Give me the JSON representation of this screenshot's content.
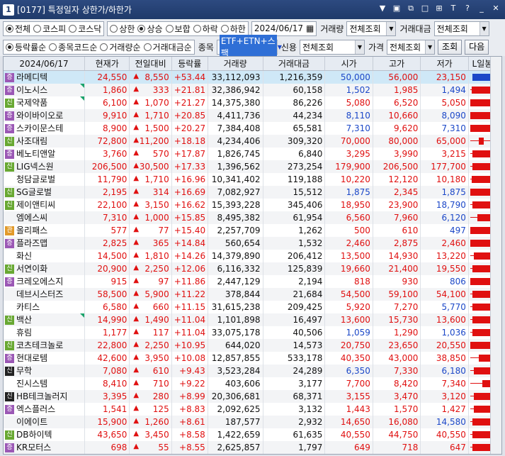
{
  "window": {
    "number": "1",
    "title": "[0177] 특정일자 상한가/하한가"
  },
  "filter1": {
    "market": [
      "전체",
      "코스피",
      "코스닥"
    ],
    "market_selected": 0,
    "direction": [
      "상한",
      "상승",
      "보합",
      "하락",
      "하한"
    ],
    "direction_selected": 1,
    "date": "2024/06/17",
    "volume_label": "거래량",
    "volume_value": "전체조회",
    "amount_label": "거래대금",
    "amount_value": "전체조회"
  },
  "filter2": {
    "sort": [
      "등락률순",
      "종목코드순",
      "거래량순",
      "거래대금순"
    ],
    "sort_selected": 0,
    "item_label": "종목",
    "item_value": "ETF+ETN+스팩",
    "credit_label": "신용",
    "credit_value": "전체조회",
    "price_label": "가격",
    "price_value": "전체조회",
    "search_button": "조회",
    "next_button": "다음"
  },
  "table": {
    "headers": [
      "2024/06/17",
      "현재가",
      "전일대비",
      "등락률",
      "거래량",
      "거래대금",
      "시가",
      "고가",
      "저가",
      "L일봉H"
    ],
    "rows": [
      {
        "tag": "증",
        "tc": "p",
        "name": "라메디텍",
        "price": "24,550",
        "chg": "8,550",
        "rate": "+53.44",
        "vol": "33,112,093",
        "amt": "1,216,359",
        "open": "50,000",
        "high": "56,000",
        "low": "23,150",
        "ob": true,
        "hb": false,
        "lb": false,
        "bar": [
          10,
          95,
          10,
          95,
          "b"
        ],
        "sel": true
      },
      {
        "tag": "증",
        "tc": "p",
        "name": "이노시스",
        "price": "1,860",
        "chg": "333",
        "rate": "+21.81",
        "vol": "32,386,942",
        "amt": "60,158",
        "open": "1,502",
        "high": "1,985",
        "low": "1,494",
        "ob": true,
        "hb": false,
        "lb": true,
        "bar": [
          5,
          95,
          8,
          80,
          "r"
        ],
        "flag": true
      },
      {
        "tag": "신",
        "tc": "g",
        "name": "국제약품",
        "price": "6,100",
        "chg": "1,070",
        "rate": "+21.27",
        "vol": "14,375,380",
        "amt": "86,226",
        "open": "5,080",
        "high": "6,520",
        "low": "5,050",
        "ob": false,
        "hb": false,
        "lb": false,
        "bar": [
          5,
          95,
          5,
          80,
          "r"
        ],
        "flag": true
      },
      {
        "tag": "증",
        "tc": "p",
        "name": "와이바이오로",
        "price": "9,910",
        "chg": "1,710",
        "rate": "+20.85",
        "vol": "4,411,736",
        "amt": "44,234",
        "open": "8,110",
        "high": "10,660",
        "low": "8,090",
        "ob": true,
        "hb": false,
        "lb": true,
        "bar": [
          5,
          95,
          5,
          75,
          "r"
        ]
      },
      {
        "tag": "증",
        "tc": "p",
        "name": "스카이문스테",
        "price": "8,900",
        "chg": "1,500",
        "rate": "+20.27",
        "vol": "7,384,408",
        "amt": "65,581",
        "open": "7,310",
        "high": "9,620",
        "low": "7,310",
        "ob": true,
        "hb": false,
        "lb": true,
        "bar": [
          5,
          95,
          5,
          72,
          "r"
        ]
      },
      {
        "tag": "신",
        "tc": "g",
        "name": "사조대림",
        "price": "72,800",
        "chg": "11,200",
        "rate": "+18.18",
        "vol": "4,234,406",
        "amt": "309,320",
        "open": "70,000",
        "high": "80,000",
        "low": "65,000",
        "ob": false,
        "hb": false,
        "lb": false,
        "bar": [
          5,
          95,
          30,
          45,
          "r"
        ]
      },
      {
        "tag": "증",
        "tc": "p",
        "name": "베노티앤알",
        "price": "3,760",
        "chg": "570",
        "rate": "+17.87",
        "vol": "1,826,745",
        "amt": "6,840",
        "open": "3,295",
        "high": "3,990",
        "low": "3,215",
        "ob": false,
        "hb": false,
        "lb": false,
        "bar": [
          5,
          95,
          10,
          80,
          "r"
        ]
      },
      {
        "tag": "신",
        "tc": "g",
        "name": "LIG넥스원",
        "price": "206,500",
        "chg": "30,500",
        "rate": "+17.33",
        "vol": "1,396,562",
        "amt": "273,254",
        "open": "179,900",
        "high": "206,500",
        "low": "177,700",
        "ob": false,
        "hb": false,
        "lb": false,
        "bar": [
          5,
          95,
          10,
          95,
          "r"
        ]
      },
      {
        "tag": "",
        "tc": "n",
        "name": "청담글로벌",
        "price": "11,790",
        "chg": "1,710",
        "rate": "+16.96",
        "vol": "10,341,402",
        "amt": "119,188",
        "open": "10,220",
        "high": "12,120",
        "low": "10,180",
        "ob": false,
        "hb": false,
        "lb": false,
        "bar": [
          5,
          95,
          8,
          82,
          "r"
        ]
      },
      {
        "tag": "신",
        "tc": "g",
        "name": "SG글로벌",
        "price": "2,195",
        "chg": "314",
        "rate": "+16.69",
        "vol": "7,082,927",
        "amt": "15,512",
        "open": "1,875",
        "high": "2,345",
        "low": "1,875",
        "ob": true,
        "hb": false,
        "lb": true,
        "bar": [
          5,
          95,
          5,
          80,
          "r"
        ]
      },
      {
        "tag": "신",
        "tc": "g",
        "name": "제이앤티씨",
        "price": "22,100",
        "chg": "3,150",
        "rate": "+16.62",
        "vol": "15,393,228",
        "amt": "345,406",
        "open": "18,950",
        "high": "23,900",
        "low": "18,790",
        "ob": false,
        "hb": false,
        "lb": true,
        "bar": [
          5,
          95,
          10,
          75,
          "r"
        ]
      },
      {
        "tag": "",
        "tc": "n",
        "name": "엠에스씨",
        "price": "7,310",
        "chg": "1,000",
        "rate": "+15.85",
        "vol": "8,495,382",
        "amt": "61,954",
        "open": "6,560",
        "high": "7,960",
        "low": "6,120",
        "ob": false,
        "hb": false,
        "lb": true,
        "bar": [
          5,
          95,
          25,
          75,
          "r"
        ]
      },
      {
        "tag": "관",
        "tc": "o",
        "name": "올리패스",
        "price": "577",
        "chg": "77",
        "rate": "+15.40",
        "vol": "2,257,709",
        "amt": "1,262",
        "open": "500",
        "high": "610",
        "low": "497",
        "ob": false,
        "hb": false,
        "lb": true,
        "bar": [
          5,
          95,
          5,
          70,
          "r"
        ]
      },
      {
        "tag": "증",
        "tc": "p",
        "name": "플라즈맵",
        "price": "2,825",
        "chg": "365",
        "rate": "+14.84",
        "vol": "560,654",
        "amt": "1,532",
        "open": "2,460",
        "high": "2,875",
        "low": "2,460",
        "ob": false,
        "hb": false,
        "lb": false,
        "bar": [
          5,
          95,
          5,
          85,
          "r"
        ]
      },
      {
        "tag": "",
        "tc": "n",
        "name": "화신",
        "price": "14,500",
        "chg": "1,810",
        "rate": "+14.26",
        "vol": "14,379,890",
        "amt": "206,412",
        "open": "13,500",
        "high": "14,930",
        "low": "13,220",
        "ob": false,
        "hb": false,
        "lb": false,
        "bar": [
          5,
          95,
          15,
          80,
          "r"
        ]
      },
      {
        "tag": "신",
        "tc": "g",
        "name": "서연이화",
        "price": "20,900",
        "chg": "2,250",
        "rate": "+12.06",
        "vol": "6,116,332",
        "amt": "125,839",
        "open": "19,660",
        "high": "21,400",
        "low": "19,550",
        "ob": false,
        "hb": false,
        "lb": false,
        "bar": [
          5,
          95,
          10,
          80,
          "r"
        ]
      },
      {
        "tag": "증",
        "tc": "p",
        "name": "크레오에스지",
        "price": "915",
        "chg": "97",
        "rate": "+11.86",
        "vol": "2,447,129",
        "amt": "2,194",
        "open": "818",
        "high": "930",
        "low": "806",
        "ob": false,
        "hb": false,
        "lb": true,
        "bar": [
          5,
          95,
          5,
          85,
          "r"
        ]
      },
      {
        "tag": "",
        "tc": "n",
        "name": "데브시스터즈",
        "price": "58,500",
        "chg": "5,900",
        "rate": "+11.22",
        "vol": "378,844",
        "amt": "21,684",
        "open": "54,500",
        "high": "59,100",
        "low": "54,100",
        "ob": false,
        "hb": false,
        "lb": false,
        "bar": [
          5,
          95,
          10,
          90,
          "r"
        ]
      },
      {
        "tag": "",
        "tc": "n",
        "name": "카티스",
        "price": "6,580",
        "chg": "660",
        "rate": "+11.15",
        "vol": "31,615,238",
        "amt": "209,425",
        "open": "5,920",
        "high": "7,270",
        "low": "5,770",
        "ob": false,
        "hb": false,
        "lb": true,
        "bar": [
          5,
          95,
          10,
          70,
          "r"
        ]
      },
      {
        "tag": "신",
        "tc": "g",
        "name": "백산",
        "price": "14,990",
        "chg": "1,490",
        "rate": "+11.04",
        "vol": "1,101,898",
        "amt": "16,497",
        "open": "13,600",
        "high": "15,730",
        "low": "13,600",
        "ob": false,
        "hb": false,
        "lb": false,
        "bar": [
          5,
          95,
          10,
          85,
          "r"
        ],
        "flag": true
      },
      {
        "tag": "",
        "tc": "n",
        "name": "휴림",
        "price": "1,177",
        "chg": "117",
        "rate": "+11.04",
        "vol": "33,075,178",
        "amt": "40,506",
        "open": "1,059",
        "high": "1,290",
        "low": "1,036",
        "ob": true,
        "hb": false,
        "lb": true,
        "bar": [
          5,
          95,
          10,
          75,
          "r"
        ]
      },
      {
        "tag": "신",
        "tc": "g",
        "name": "코츠테크놀로",
        "price": "22,800",
        "chg": "2,250",
        "rate": "+10.95",
        "vol": "644,020",
        "amt": "14,573",
        "open": "20,750",
        "high": "23,650",
        "low": "20,550",
        "ob": false,
        "hb": false,
        "lb": false,
        "bar": [
          5,
          95,
          5,
          80,
          "r"
        ]
      },
      {
        "tag": "증",
        "tc": "p",
        "name": "현대로템",
        "price": "42,600",
        "chg": "3,950",
        "rate": "+10.08",
        "vol": "12,857,855",
        "amt": "533,178",
        "open": "40,350",
        "high": "43,000",
        "low": "38,850",
        "ob": false,
        "hb": false,
        "lb": false,
        "bar": [
          5,
          95,
          30,
          85,
          "r"
        ]
      },
      {
        "tag": "신",
        "tc": "k",
        "name": "무학",
        "price": "7,080",
        "chg": "610",
        "rate": "+9.43",
        "vol": "3,523,284",
        "amt": "24,289",
        "open": "6,350",
        "high": "7,330",
        "low": "6,180",
        "ob": true,
        "hb": false,
        "lb": true,
        "bar": [
          5,
          95,
          15,
          80,
          "r"
        ]
      },
      {
        "tag": "",
        "tc": "n",
        "name": "진시스템",
        "price": "8,410",
        "chg": "710",
        "rate": "+9.22",
        "vol": "403,606",
        "amt": "3,177",
        "open": "7,700",
        "high": "8,420",
        "low": "7,340",
        "ob": false,
        "hb": false,
        "lb": false,
        "bar": [
          5,
          95,
          40,
          95,
          "r"
        ]
      },
      {
        "tag": "신",
        "tc": "k",
        "name": "HB테크놀러지",
        "price": "3,395",
        "chg": "280",
        "rate": "+8.99",
        "vol": "20,306,681",
        "amt": "68,371",
        "open": "3,155",
        "high": "3,470",
        "low": "3,120",
        "ob": false,
        "hb": false,
        "lb": false,
        "bar": [
          5,
          95,
          15,
          85,
          "r"
        ]
      },
      {
        "tag": "증",
        "tc": "p",
        "name": "엑스플러스",
        "price": "1,541",
        "chg": "125",
        "rate": "+8.83",
        "vol": "2,092,625",
        "amt": "3,132",
        "open": "1,443",
        "high": "1,570",
        "low": "1,427",
        "ob": false,
        "hb": false,
        "lb": false,
        "bar": [
          5,
          95,
          15,
          80,
          "r"
        ]
      },
      {
        "tag": "",
        "tc": "n",
        "name": "이에이트",
        "price": "15,900",
        "chg": "1,260",
        "rate": "+8.61",
        "vol": "187,577",
        "amt": "2,932",
        "open": "14,650",
        "high": "16,080",
        "low": "14,580",
        "ob": false,
        "hb": false,
        "lb": true,
        "bar": [
          5,
          95,
          10,
          85,
          "r"
        ]
      },
      {
        "tag": "신",
        "tc": "g",
        "name": "DB하이텍",
        "price": "43,650",
        "chg": "3,450",
        "rate": "+8.58",
        "vol": "1,422,659",
        "amt": "61,635",
        "open": "40,550",
        "high": "44,750",
        "low": "40,550",
        "ob": false,
        "hb": false,
        "lb": false,
        "bar": [
          5,
          95,
          10,
          80,
          "r"
        ]
      },
      {
        "tag": "증",
        "tc": "p",
        "name": "KR모터스",
        "price": "698",
        "chg": "55",
        "rate": "+8.55",
        "vol": "2,625,857",
        "amt": "1,797",
        "open": "649",
        "high": "718",
        "low": "647",
        "ob": false,
        "hb": false,
        "lb": false,
        "bar": [
          5,
          95,
          10,
          85,
          "r"
        ]
      }
    ]
  }
}
